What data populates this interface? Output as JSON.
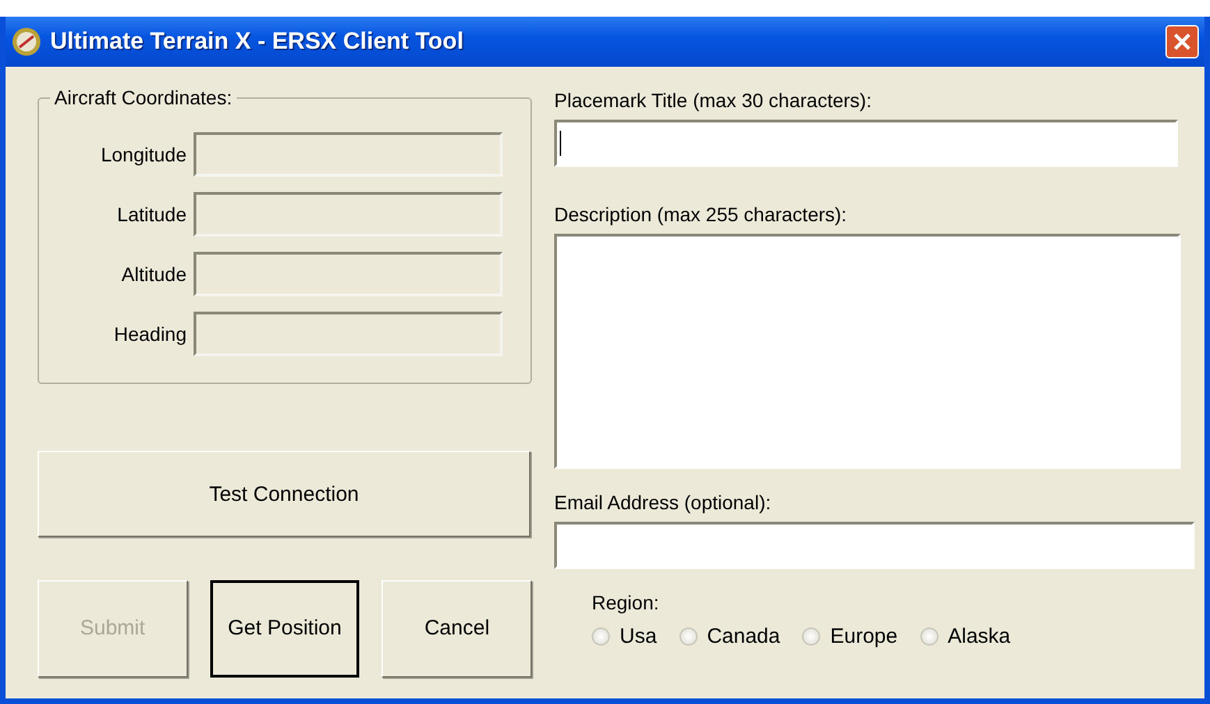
{
  "window": {
    "title": "Ultimate Terrain X - ERSX Client Tool"
  },
  "coordinates": {
    "legend": "Aircraft Coordinates:",
    "fields": [
      {
        "label": "Longitude"
      },
      {
        "label": "Latitude"
      },
      {
        "label": "Altitude"
      },
      {
        "label": "Heading"
      }
    ]
  },
  "test_button": {
    "label": "Test Connection"
  },
  "buttons": [
    {
      "label": "Submit",
      "disabled": true,
      "default": false
    },
    {
      "label": "Get Position",
      "disabled": false,
      "default": true
    },
    {
      "label": "Cancel",
      "disabled": false,
      "default": false
    }
  ],
  "placemark": {
    "label": "Placemark Title (max 30 characters):",
    "focused": true
  },
  "description": {
    "label": "Description (max 255 characters):"
  },
  "email": {
    "label": "Email Address (optional):"
  },
  "region": {
    "label": "Region:",
    "options": [
      {
        "label": "Usa",
        "selected": false
      },
      {
        "label": "Canada",
        "selected": false
      },
      {
        "label": "Europe",
        "selected": false
      },
      {
        "label": "Alaska",
        "selected": false
      }
    ]
  }
}
